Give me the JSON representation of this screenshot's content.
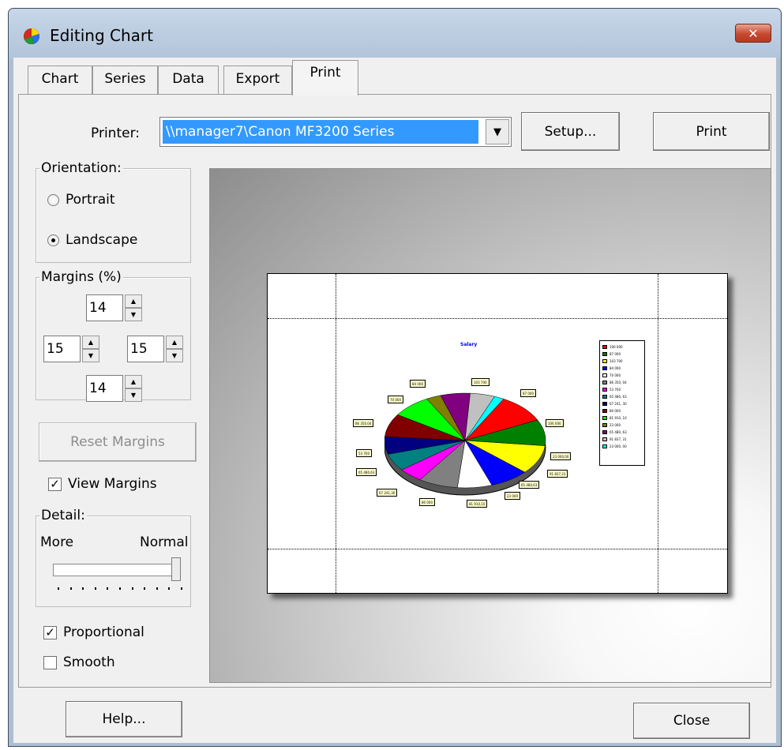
{
  "window": {
    "title": "Editing Chart",
    "close_glyph": "✕",
    "app_icon": "chart-app-icon"
  },
  "tabs": [
    {
      "label": "Chart",
      "active": false
    },
    {
      "label": "Series",
      "active": false
    },
    {
      "label": "Data",
      "active": false
    },
    {
      "label": "Export",
      "active": false
    },
    {
      "label": "Print",
      "active": true
    }
  ],
  "printer": {
    "label": "Printer:",
    "selected": "\\\\manager7\\Canon MF3200 Series",
    "setup_label": "Setup...",
    "print_label": "Print"
  },
  "orientation": {
    "title": "Orientation:",
    "portrait_label": "Portrait",
    "landscape_label": "Landscape",
    "selected": "Landscape"
  },
  "margins": {
    "title": "Margins (%)",
    "top": "14",
    "left": "15",
    "right": "15",
    "bottom": "14"
  },
  "reset_margins_label": "Reset Margins",
  "view_margins": {
    "label": "View Margins",
    "checked": true
  },
  "detail": {
    "title": "Detail:",
    "more_label": "More",
    "normal_label": "Normal",
    "level": 1.0
  },
  "proportional": {
    "label": "Proportional",
    "checked": true
  },
  "smooth": {
    "label": "Smooth",
    "checked": false
  },
  "footer": {
    "help_label": "Help...",
    "close_label": "Close"
  },
  "preview": {
    "chart_title": "Salary",
    "slice_colors": [
      "#ff0000",
      "#008000",
      "#ffff00",
      "#0000ff",
      "#ffffff",
      "#808080",
      "#ff00ff",
      "#008080",
      "#000080",
      "#800000",
      "#00ff00",
      "#808000",
      "#800080",
      "#c0c0c0",
      "#00ffff"
    ],
    "legend": [
      {
        "color": "#ff0000",
        "text": "106 000"
      },
      {
        "color": "#008000",
        "text": "87 000"
      },
      {
        "color": "#ffff00",
        "text": "103 700"
      },
      {
        "color": "#0000ff",
        "text": "84 000"
      },
      {
        "color": "#ffffff",
        "text": "70 000"
      },
      {
        "color": "#808080",
        "text": "86 350, 04"
      },
      {
        "color": "#ff00ff",
        "text": "53 700"
      },
      {
        "color": "#008080",
        "text": "65 480, 63"
      },
      {
        "color": "#000080",
        "text": "67 241, 30"
      },
      {
        "color": "#800000",
        "text": "80 000"
      },
      {
        "color": "#00ff00",
        "text": "81 910, 10"
      },
      {
        "color": "#808000",
        "text": "23 000"
      },
      {
        "color": "#800080",
        "text": "65 480, 63"
      },
      {
        "color": "#c0c0c0",
        "text": "91 837, 31"
      },
      {
        "color": "#00ffff",
        "text": "23 000, 00"
      }
    ],
    "labels": [
      "103 700",
      "87 000",
      "106 000",
      "84 000",
      "70 000",
      "86 350,04",
      "53 700",
      "65 480,63",
      "67 241,30",
      "80 000",
      "81 910,10",
      "23 000",
      "65 480,63",
      "91 837,31",
      "23 000,00"
    ]
  }
}
